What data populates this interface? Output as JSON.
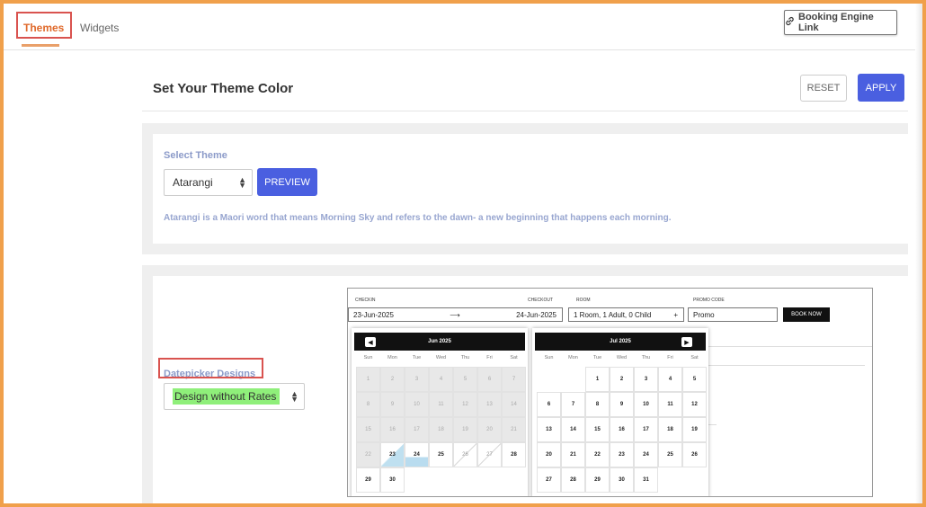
{
  "tabs": {
    "themes": "Themes",
    "widgets": "Widgets"
  },
  "booking_engine_link": "Booking Engine Link",
  "page_title": "Set Your Theme Color",
  "buttons": {
    "reset": "RESET",
    "apply": "APPLY",
    "preview": "PREVIEW"
  },
  "select_theme": {
    "label": "Select Theme",
    "value": "Atarangi"
  },
  "description": "Atarangi is a Maori word that means Morning Sky and refers to the dawn- a new beginning that happens each morning.",
  "datepicker": {
    "label": "Datepicker Designs",
    "value": "Design without Rates"
  },
  "preview": {
    "checkin_label": "CHECKIN",
    "checkout_label": "CHECKOUT",
    "room_label": "ROOM",
    "promo_label": "PROMO CODE",
    "checkin": "23-Jun-2025",
    "arrow": "⟶",
    "checkout": "24-Jun-2025",
    "room": "1 Room, 1 Adult, 0 Child",
    "room_plus": "+",
    "promo": "Promo",
    "book_now": "BOOK NOW",
    "months": [
      {
        "title": "Jun 2025",
        "weeks": [
          [
            "1",
            "2",
            "3",
            "4",
            "5",
            "6",
            "7"
          ],
          [
            "8",
            "9",
            "10",
            "11",
            "12",
            "13",
            "14"
          ],
          [
            "15",
            "16",
            "17",
            "18",
            "19",
            "20",
            "21"
          ],
          [
            "22",
            "23",
            "24",
            "25",
            "26",
            "27",
            "28"
          ],
          [
            "29",
            "30",
            "",
            "",
            "",
            "",
            ""
          ]
        ]
      },
      {
        "title": "Jul 2025",
        "weeks": [
          [
            "",
            "",
            "1",
            "2",
            "3",
            "4",
            "5"
          ],
          [
            "6",
            "7",
            "8",
            "9",
            "10",
            "11",
            "12"
          ],
          [
            "13",
            "14",
            "15",
            "16",
            "17",
            "18",
            "19"
          ],
          [
            "20",
            "21",
            "22",
            "23",
            "24",
            "25",
            "26"
          ],
          [
            "27",
            "28",
            "29",
            "30",
            "31",
            "",
            ""
          ]
        ]
      }
    ],
    "dow": [
      "Sun",
      "Mon",
      "Tue",
      "Wed",
      "Thu",
      "Fri",
      "Sat"
    ],
    "blocked_mark": "×"
  },
  "icons": {
    "link": "link-icon",
    "sort": "sort-arrows-icon",
    "prev": "chevron-left-icon",
    "next": "chevron-right-icon"
  },
  "colors": {
    "accent": "#4a5fe0",
    "active_tab": "#e06a2c",
    "highlight": "#d9534f",
    "frame": "#f0a04b",
    "selected_day": "#b9dcef",
    "option_highlight": "#8fef7a"
  }
}
